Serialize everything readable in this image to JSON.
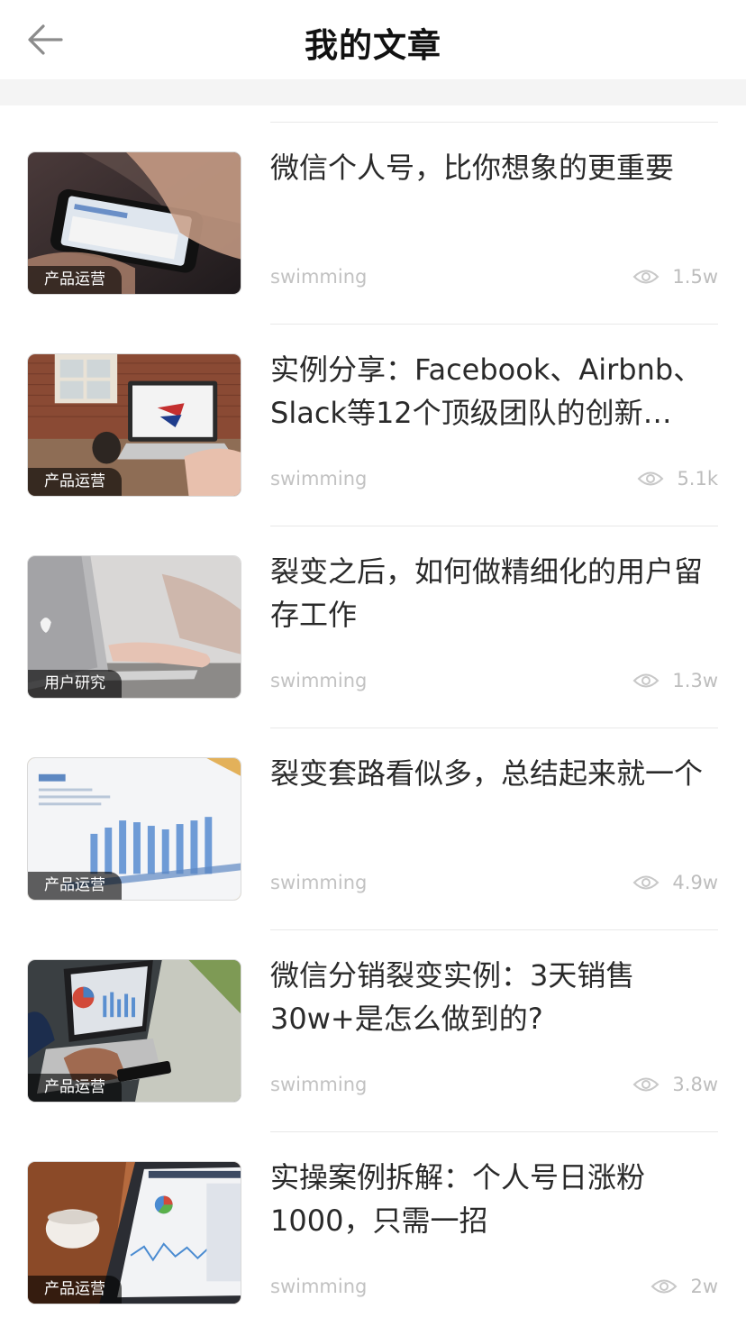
{
  "header": {
    "title": "我的文章",
    "back_icon": "arrow-left-icon"
  },
  "articles": [
    {
      "title": "微信个人号，比你想象的更重要",
      "tag": "产品运营",
      "author": "swimming",
      "views": "1.5w"
    },
    {
      "title": "实例分享：Facebook、Airbnb、Slack等12个顶级团队的创新…",
      "tag": "产品运营",
      "author": "swimming",
      "views": "5.1k"
    },
    {
      "title": "裂变之后，如何做精细化的用户留存工作",
      "tag": "用户研究",
      "author": "swimming",
      "views": "1.3w"
    },
    {
      "title": "裂变套路看似多，总结起来就一个",
      "tag": "产品运营",
      "author": "swimming",
      "views": "4.9w"
    },
    {
      "title": "微信分销裂变实例：3天销售30w+是怎么做到的?",
      "tag": "产品运营",
      "author": "swimming",
      "views": "3.8w"
    },
    {
      "title": "实操案例拆解：个人号日涨粉1000，只需一招",
      "tag": "产品运营",
      "author": "swimming",
      "views": "2w"
    }
  ],
  "colors": {
    "text": "#2a2a2a",
    "muted": "#c2c2c2",
    "band": "#f4f4f4",
    "divider": "#e8e8e8"
  }
}
